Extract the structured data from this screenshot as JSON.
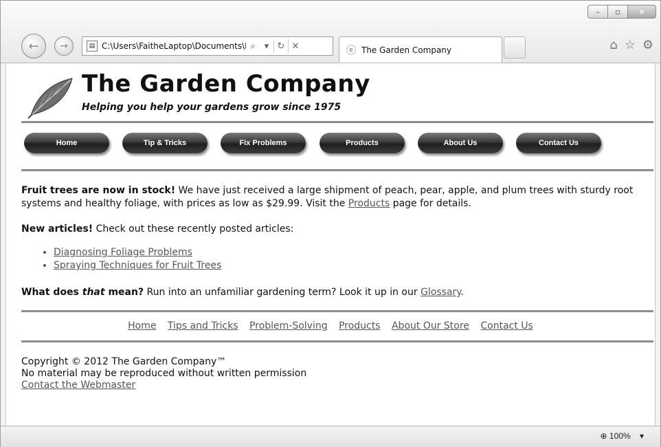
{
  "browser": {
    "window_buttons": {
      "minimize": "–",
      "maximize": "▫",
      "close": "✕"
    },
    "back_icon": "back-arrow-icon",
    "forward_icon": "forward-arrow-icon",
    "address": "C:\\Users\\FaitheLaptop\\Documents\\N",
    "tab_title": "The Garden Company",
    "zoom": "100%"
  },
  "site": {
    "title": "The Garden Company",
    "tagline": "Helping you help your gardens grow since 1975"
  },
  "nav": [
    "Home",
    "Tip & Tricks",
    "Fix Problems",
    "Products",
    "About Us",
    "Contact Us"
  ],
  "main": {
    "p1_bold": "Fruit trees are now in stock!",
    "p1_text": " We have just received a large shipment of peach, pear, apple, and plum trees with sturdy root systems and healthy foliage, with prices as low as $29.99. Visit the ",
    "p1_link": "Products",
    "p1_end": " page for details.",
    "p2_bold": "New articles!",
    "p2_text": " Check out these recently posted articles:",
    "articles": [
      "Diagnosing Foliage Problems",
      "Spraying Techniques for Fruit Trees"
    ],
    "p3_bold_a": "What does ",
    "p3_bold_italic": "that",
    "p3_bold_b": " mean?",
    "p3_text": " Run into an unfamiliar gardening term? Look it up in our ",
    "p3_link": "Glossary",
    "p3_end": "."
  },
  "footer_nav": [
    "Home",
    "Tips and Tricks",
    "Problem-Solving",
    "Products",
    "About Our Store",
    "Contact Us"
  ],
  "footer": {
    "copyright": "Copyright © 2012 The Garden Company™",
    "notice": "No material may be reproduced without written permission",
    "webmaster_link": "Contact the Webmaster"
  }
}
